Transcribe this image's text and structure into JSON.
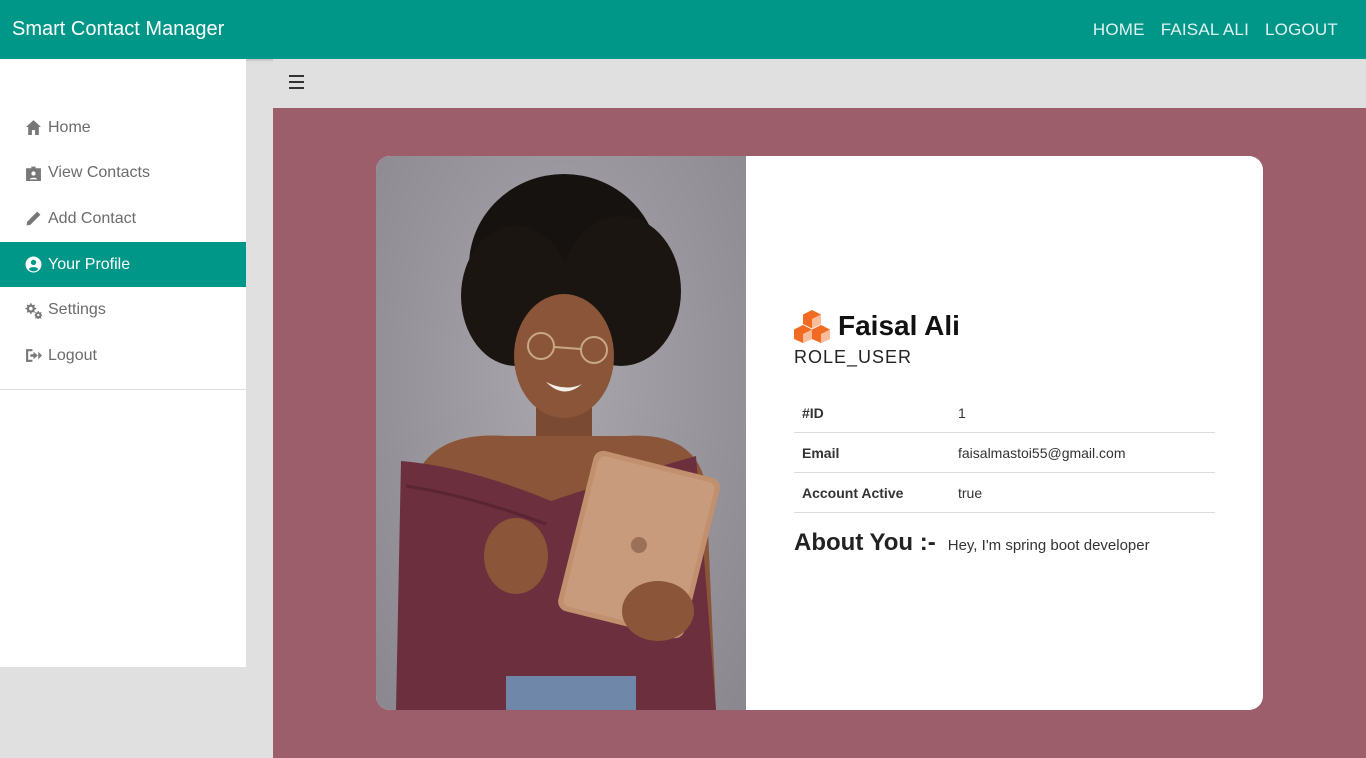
{
  "navbar": {
    "brand": "Smart Contact Manager",
    "links": [
      "HOME",
      "FAISAL ALI",
      "LOGOUT"
    ]
  },
  "sidebar": {
    "items": [
      {
        "label": "Home",
        "icon": "home-icon"
      },
      {
        "label": "View Contacts",
        "icon": "contacts-icon"
      },
      {
        "label": "Add Contact",
        "icon": "pencil-icon"
      },
      {
        "label": "Your Profile",
        "icon": "user-circle-icon",
        "active": true
      },
      {
        "label": "Settings",
        "icon": "gears-icon"
      },
      {
        "label": "Logout",
        "icon": "logout-icon"
      }
    ]
  },
  "profile": {
    "name": "Faisal Ali",
    "role": "ROLE_USER",
    "fields": [
      {
        "key": "#ID",
        "value": "1"
      },
      {
        "key": "Email",
        "value": "faisalmastoi55@gmail.com"
      },
      {
        "key": "Account Active",
        "value": "true"
      }
    ],
    "about_title": "About You :-",
    "about_text": "Hey, I'm spring boot developer"
  },
  "colors": {
    "primary": "#009688",
    "content_bg": "#9b5e6a",
    "logo_orange": "#f26b22"
  }
}
